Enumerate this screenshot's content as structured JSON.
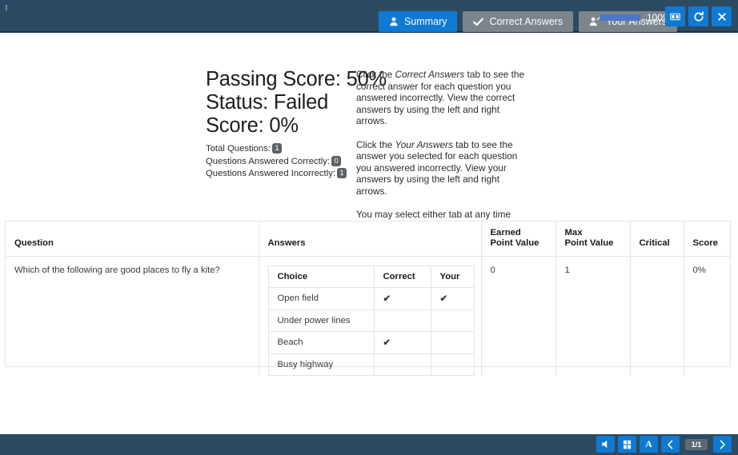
{
  "topbar": {
    "tabs": [
      {
        "label": "Summary",
        "icon": "person-icon",
        "active": true
      },
      {
        "label": "Correct Answers",
        "icon": "check-icon",
        "active": false
      },
      {
        "label": "Your Answers",
        "icon": "person-check-icon",
        "active": false
      }
    ],
    "progress": {
      "value": 100,
      "label": "100%"
    },
    "buttons": [
      {
        "name": "panels-icon",
        "label": ""
      },
      {
        "name": "refresh-icon",
        "label": ""
      },
      {
        "name": "close-icon",
        "label": ""
      }
    ]
  },
  "summary": {
    "passing_score": "Passing Score: 50%",
    "status": "Status: Failed",
    "score": "Score: 0%",
    "stats": [
      {
        "label": "Total Questions:",
        "value": "1"
      },
      {
        "label": "Questions Answered Correctly:",
        "value": "0"
      },
      {
        "label": "Questions Answered Incorrectly:",
        "value": "1"
      }
    ],
    "paragraphs": [
      {
        "pre": "Click the ",
        "em": "Correct Answers",
        "post": " tab to see the correct answer for each question you answered incorrectly. View the correct answers by using the left and right arrows."
      },
      {
        "pre": "Click the ",
        "em": "Your Answers",
        "post": " tab to see the answer you selected for each question you answered incorrectly. View your answers by using the left and right arrows."
      },
      {
        "pre": "You may select either tab at any time and navigate within the tab contents by using the left and right arrows.",
        "em": "",
        "post": ""
      }
    ]
  },
  "table": {
    "headers": [
      "Question",
      "Answers",
      "Earned\nPoint Value",
      "Max\nPoint Value",
      "Critical",
      "Score"
    ],
    "headers_lines": {
      "question": "Question",
      "answers": "Answers",
      "earned_l1": "Earned",
      "earned_l2": "Point Value",
      "max_l1": "Max",
      "max_l2": "Point Value",
      "critical": "Critical",
      "score": "Score"
    },
    "row": {
      "question": "Which of the following are good places to fly a kite?",
      "earned_point_value": "0",
      "max_point_value": "1",
      "critical": "",
      "score": "0%"
    },
    "answers_table": {
      "headers": [
        "Choice",
        "Correct",
        "Your"
      ],
      "rows": [
        {
          "choice": "Open field",
          "correct": "✔",
          "your": "✔"
        },
        {
          "choice": "Under power lines",
          "correct": "",
          "your": ""
        },
        {
          "choice": "Beach",
          "correct": "✔",
          "your": ""
        },
        {
          "choice": "Busy highway",
          "correct": "",
          "your": ""
        }
      ]
    }
  },
  "bottombar": {
    "buttons": [
      {
        "name": "volume-icon"
      },
      {
        "name": "notes-icon"
      },
      {
        "name": "font-size-icon",
        "label": "A"
      },
      {
        "name": "prev-page-icon"
      }
    ],
    "page_indicator": "1/1",
    "next_label": ""
  },
  "colors": {
    "chrome": "#2d4a63",
    "accent": "#1079d2",
    "tab_inactive": "#7c858c",
    "correct_green": "#2ea12e",
    "badge_gray": "#5a6268"
  }
}
